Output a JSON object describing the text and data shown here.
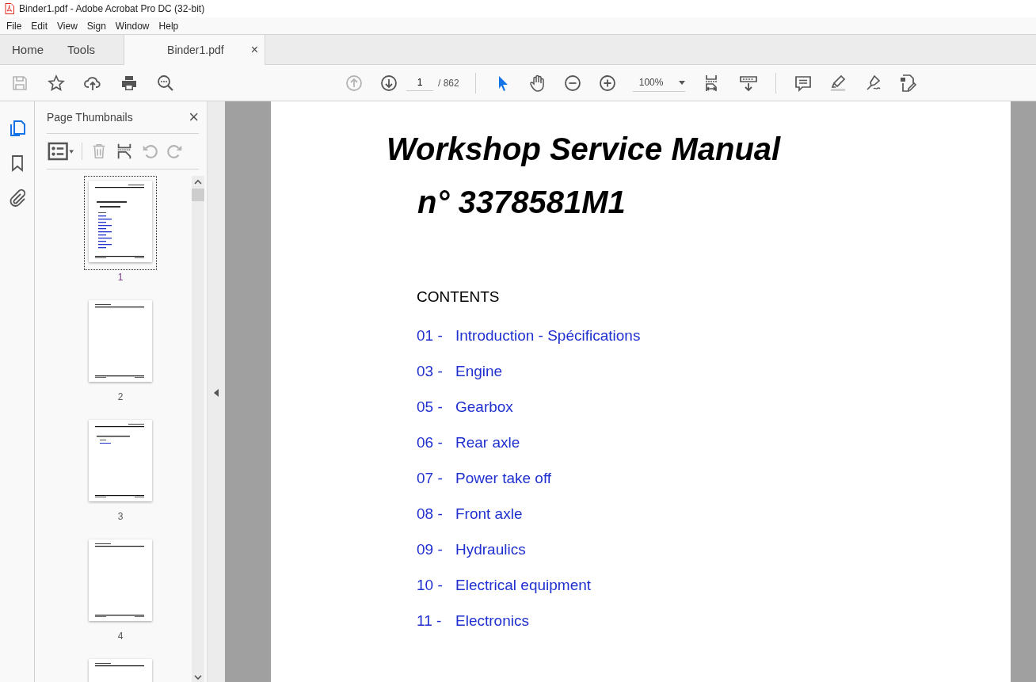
{
  "window": {
    "title": "Binder1.pdf - Adobe Acrobat Pro DC (32-bit)"
  },
  "menu": [
    "File",
    "Edit",
    "View",
    "Sign",
    "Window",
    "Help"
  ],
  "tabs": [
    {
      "label": "Home",
      "selected": false
    },
    {
      "label": "Tools",
      "selected": false
    },
    {
      "label": "Binder1.pdf",
      "selected": true,
      "close": "×"
    }
  ],
  "toolbar": {
    "left_tools": [
      {
        "kind": "save",
        "disabled": true
      },
      {
        "kind": "star",
        "disabled": false
      },
      {
        "kind": "upload",
        "disabled": false
      },
      {
        "kind": "print",
        "disabled": false
      },
      {
        "kind": "search",
        "disabled": false
      }
    ],
    "nav_tools": [
      {
        "kind": "page-up",
        "disabled": true
      },
      {
        "kind": "page-down",
        "disabled": false
      }
    ],
    "page_number": "1",
    "page_total": "/ 862",
    "view_tools": [
      {
        "kind": "select",
        "disabled": false
      },
      {
        "kind": "hand",
        "disabled": false
      },
      {
        "kind": "zoom-out",
        "disabled": false
      },
      {
        "kind": "zoom-in",
        "disabled": false
      }
    ],
    "zoom": "100%",
    "right_tools": [
      {
        "kind": "fit",
        "disabled": false
      },
      {
        "kind": "scroll",
        "disabled": false
      }
    ],
    "edit_tools": [
      {
        "kind": "comment",
        "disabled": false
      },
      {
        "kind": "highlight",
        "disabled": false
      },
      {
        "kind": "sign",
        "disabled": false
      },
      {
        "kind": "edit",
        "disabled": false
      }
    ]
  },
  "rail": [
    {
      "kind": "pages",
      "selected": true
    },
    {
      "kind": "bookmark",
      "selected": false
    },
    {
      "kind": "attach",
      "selected": false
    }
  ],
  "panel": {
    "title": "Page Thumbnails",
    "close": "×",
    "tools": [
      {
        "kind": "options",
        "disabled": false
      },
      {
        "kind": "delete",
        "disabled": true
      },
      {
        "kind": "insert",
        "disabled": false
      },
      {
        "kind": "rotate-left",
        "disabled": true
      },
      {
        "kind": "rotate-right",
        "disabled": true
      }
    ],
    "thumbnails": [
      {
        "label": "1",
        "selected": true,
        "kind": "cover"
      },
      {
        "label": "2",
        "selected": false,
        "kind": "blank"
      },
      {
        "label": "3",
        "selected": false,
        "kind": "section"
      },
      {
        "label": "4",
        "selected": false,
        "kind": "blank"
      },
      {
        "selected": false,
        "kind": "blank"
      }
    ]
  },
  "document": {
    "title": "Workshop Service Manual",
    "subtitle": "n° 3378581M1",
    "contents_heading": "CONTENTS",
    "contents": [
      {
        "number": "01 -",
        "title": "Introduction - Spécifications"
      },
      {
        "number": "03 -",
        "title": "Engine"
      },
      {
        "number": "05 -",
        "title": "Gearbox"
      },
      {
        "number": "06 -",
        "title": "Rear axle"
      },
      {
        "number": "07 -",
        "title": "Power take off"
      },
      {
        "number": "08 -",
        "title": "Front axle"
      },
      {
        "number": "09 -",
        "title": "Hydraulics"
      },
      {
        "number": "10 -",
        "title": "Electrical equipment"
      },
      {
        "number": "11 -",
        "title": "Electronics"
      }
    ]
  }
}
